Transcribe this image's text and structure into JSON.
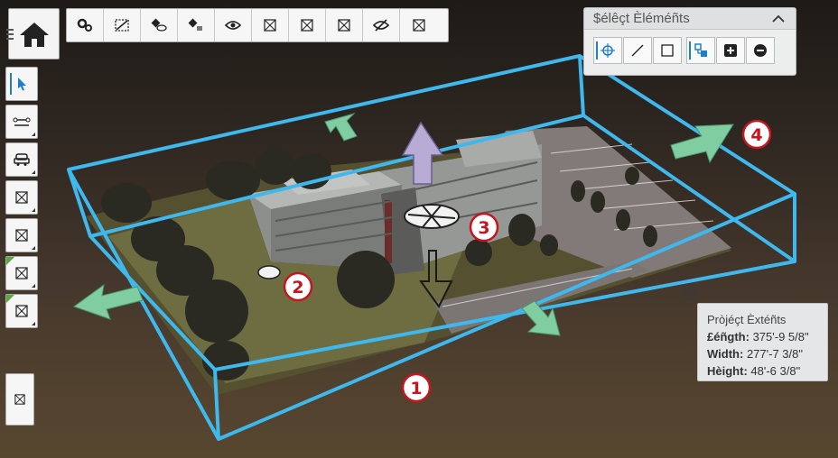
{
  "toolbar": {
    "home_icon": "home-icon",
    "buttons": [
      "settings-icon",
      "section-plane-icon",
      "hide-eraser-icon",
      "isolate-eraser-icon",
      "show-eye-icon",
      "placeholder-icon",
      "placeholder-icon",
      "placeholder-icon",
      "hidden-eye-icon",
      "placeholder-icon"
    ]
  },
  "left_tools": [
    "select-arrow-icon",
    "measure-icon",
    "vehicle-icon",
    "placeholder-icon",
    "placeholder-icon",
    "placeholder-icon",
    "placeholder-icon"
  ],
  "select_panel": {
    "title": "$élêçt Èléméñts",
    "buttons": [
      "point-select-icon",
      "line-select-icon",
      "box-select-icon",
      "select-linked-icon",
      "add-plus-icon",
      "remove-minus-icon"
    ]
  },
  "extents": {
    "title": "Pròjéçt Èxtéñts",
    "rows": [
      {
        "label": "£éñgth:",
        "value": "375'-9 5/8\""
      },
      {
        "label": "Width:",
        "value": "277'-7 3/8\""
      },
      {
        "label": "Hèight:",
        "value": "48'-6 3/8\""
      }
    ]
  },
  "callouts": [
    "1",
    "2",
    "3",
    "4"
  ],
  "colors": {
    "bounding_box": "#3fb8ee",
    "arrow": "#7fcda0",
    "callout": "#c8141e",
    "accent": "#1e7fc9"
  }
}
